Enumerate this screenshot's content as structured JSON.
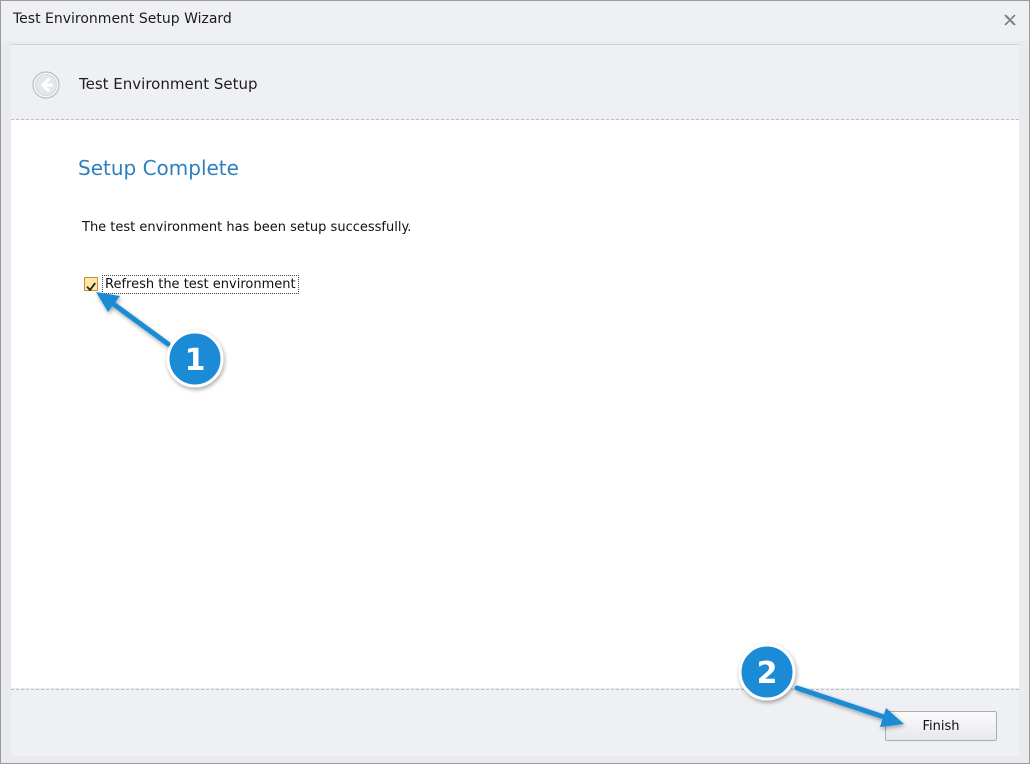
{
  "window": {
    "title": "Test Environment Setup Wizard",
    "close_icon": "close-icon"
  },
  "header": {
    "back_icon": "back-arrow-icon",
    "title": "Test Environment Setup"
  },
  "content": {
    "page_title": "Setup Complete",
    "message": "The test environment has been setup successfully.",
    "checkbox": {
      "label": "Refresh the test environment",
      "checked": true
    }
  },
  "footer": {
    "finish_label": "Finish"
  },
  "annotations": {
    "step1": "1",
    "step2": "2"
  },
  "colors": {
    "accent_blue": "#2f7fbd",
    "annotation_blue": "#1a8bd6",
    "checkbox_fill": "#ffe7a9"
  }
}
